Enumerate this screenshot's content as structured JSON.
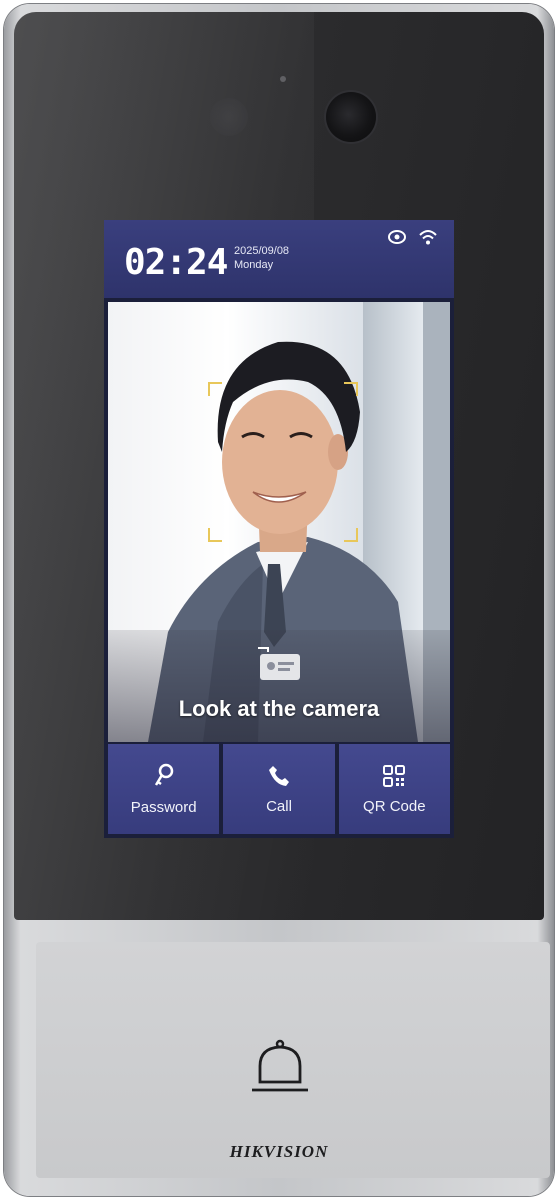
{
  "device": {
    "brand": "HIKVISION"
  },
  "status_bar": {
    "time": "02:24",
    "date_line1": "2025/09/08",
    "date_line2": "Monday",
    "icons": [
      "cloud-link-icon",
      "wifi-icon"
    ]
  },
  "camera_view": {
    "prompt": "Look at the camera",
    "prompt_icon": "card-icon"
  },
  "actions": [
    {
      "label": "Password",
      "icon": "key-icon"
    },
    {
      "label": "Call",
      "icon": "phone-icon"
    },
    {
      "label": "QR Code",
      "icon": "qr-code-icon"
    }
  ],
  "doorbell": {
    "icon": "bell-icon"
  },
  "colors": {
    "accent": "#3c418a",
    "status_bar": "#2e336b",
    "face_frame": "#e8c75a"
  }
}
